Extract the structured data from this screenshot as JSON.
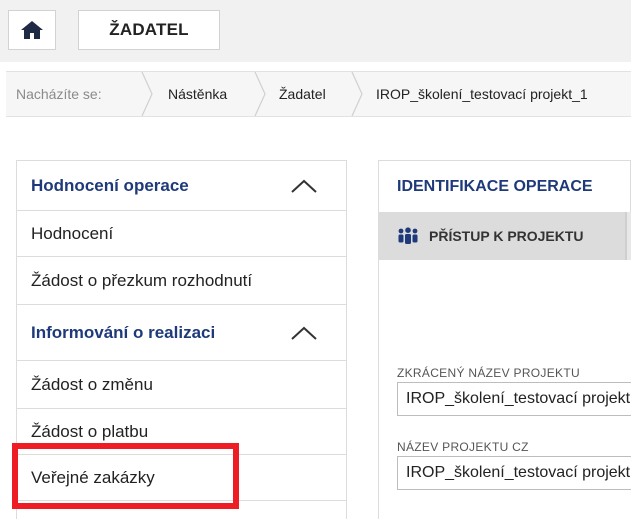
{
  "topbar": {
    "home_icon": "home-icon",
    "zadatel_label": "ŽADATEL"
  },
  "breadcrumb": {
    "label": "Nacházíte se:",
    "items": [
      "Nástěnka",
      "Žadatel",
      "IROP_školení_testovací projekt_1"
    ]
  },
  "leftmenu": {
    "sections": [
      {
        "title": "Hodnocení operace",
        "items": [
          "Hodnocení",
          "Žádost o přezkum rozhodnutí"
        ]
      },
      {
        "title": "Informování o realizaci",
        "items": [
          "Žádost o změnu",
          "Žádost o platbu",
          "Veřejné zakázky"
        ]
      }
    ]
  },
  "main": {
    "tab_label": "IDENTIFIKACE OPERACE",
    "subtab_label": "PŘÍSTUP K PROJEKTU",
    "subtab_icon": "people-icon",
    "fields": [
      {
        "label": "ZKRÁCENÝ NÁZEV PROJEKTU",
        "value": "IROP_školení_testovací projekt"
      },
      {
        "label": "NÁZEV PROJEKTU CZ",
        "value": "IROP_školení_testovací projekt"
      }
    ]
  },
  "colors": {
    "accent": "#1f3a7a",
    "highlight": "#ee1c25"
  }
}
